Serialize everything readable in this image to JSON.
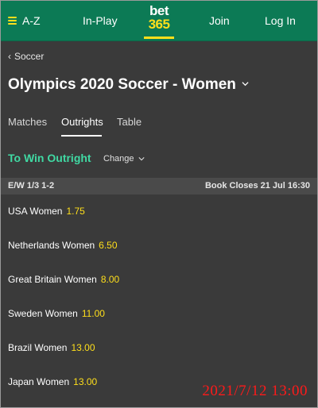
{
  "header": {
    "az_label": "A-Z",
    "inplay_label": "In-Play",
    "logo_top": "bet",
    "logo_bottom": "365",
    "join_label": "Join",
    "login_label": "Log In"
  },
  "breadcrumb": {
    "label": "Soccer"
  },
  "page": {
    "title": "Olympics 2020 Soccer - Women"
  },
  "tabs": [
    {
      "label": "Matches",
      "active": false
    },
    {
      "label": "Outrights",
      "active": true
    },
    {
      "label": "Table",
      "active": false
    }
  ],
  "market": {
    "title": "To Win Outright",
    "change_label": "Change",
    "each_way": "E/W 1/3 1-2",
    "book_closes": "Book Closes 21 Jul 16:30"
  },
  "selections": [
    {
      "name": "USA Women",
      "odds": "1.75"
    },
    {
      "name": "Netherlands Women",
      "odds": "6.50"
    },
    {
      "name": "Great Britain Women",
      "odds": "8.00"
    },
    {
      "name": "Sweden Women",
      "odds": "11.00"
    },
    {
      "name": "Brazil Women",
      "odds": "13.00"
    },
    {
      "name": "Japan Women",
      "odds": "13.00"
    }
  ],
  "watermark": "2021/7/12 13:00",
  "colors": {
    "header_bg": "#0c7a55",
    "page_bg": "#3a3a3a",
    "odds": "#ffdf1b",
    "market_title": "#40d9a3",
    "watermark": "#ff1a1a"
  }
}
